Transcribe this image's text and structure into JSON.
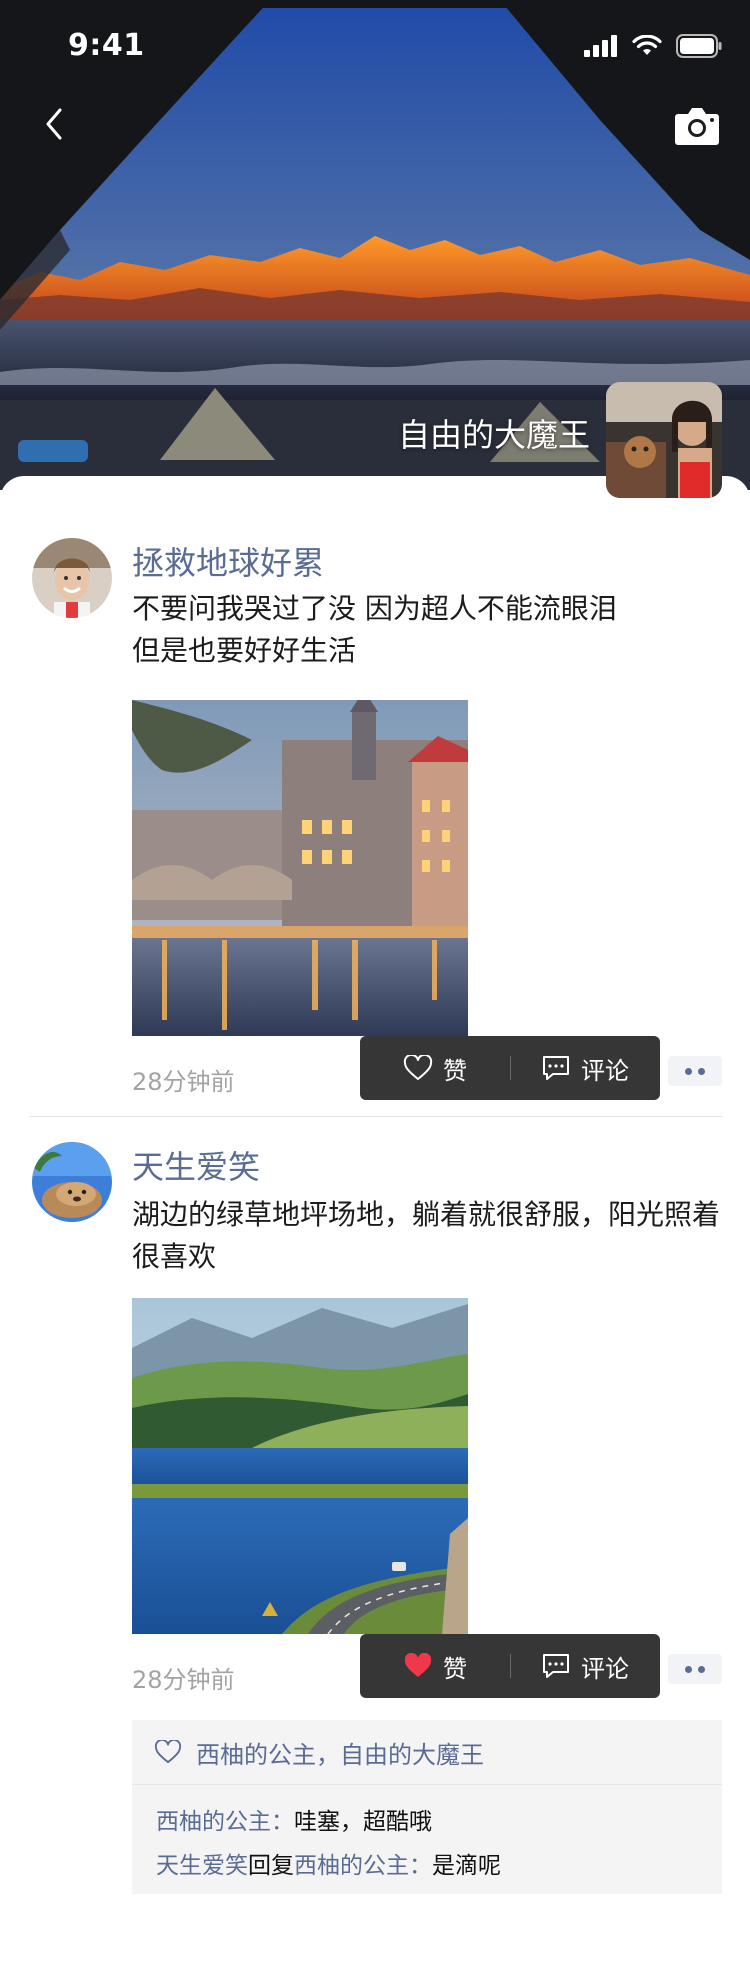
{
  "status_bar": {
    "time": "9:41"
  },
  "header": {
    "profile_name": "自由的大魔王",
    "back_icon": "chevron-left-icon",
    "camera_icon": "camera-icon"
  },
  "posts": [
    {
      "author": "拯救地球好累",
      "content": "不要问我哭过了没 因为超人不能流眼泪\n但是也要好好生活",
      "time": "28分钟前",
      "photo": "canal-city-night",
      "actions": {
        "like": "赞",
        "comment": "评论",
        "liked": false
      }
    },
    {
      "author": "天生爱笑",
      "content": "湖边的绿草地坪场地，躺着就很舒服，阳光照着很喜欢",
      "time": "28分钟前",
      "photo": "lake-green-hills",
      "actions": {
        "like": "赞",
        "comment": "评论",
        "liked": true
      },
      "likes": "西柚的公主，自由的大魔王",
      "comments": [
        {
          "name": "西柚的公主",
          "separator": "：",
          "text": "哇塞，超酷哦"
        },
        {
          "name": "天生爱笑",
          "reply_word": "回复",
          "reply_to": "西柚的公主",
          "separator": "：",
          "text": "是滴呢"
        }
      ]
    }
  ],
  "colors": {
    "name_blue": "#5a6c94",
    "popup_bg": "#363636",
    "heart_red": "#f0384a",
    "time_gray": "#a3a3a3"
  }
}
